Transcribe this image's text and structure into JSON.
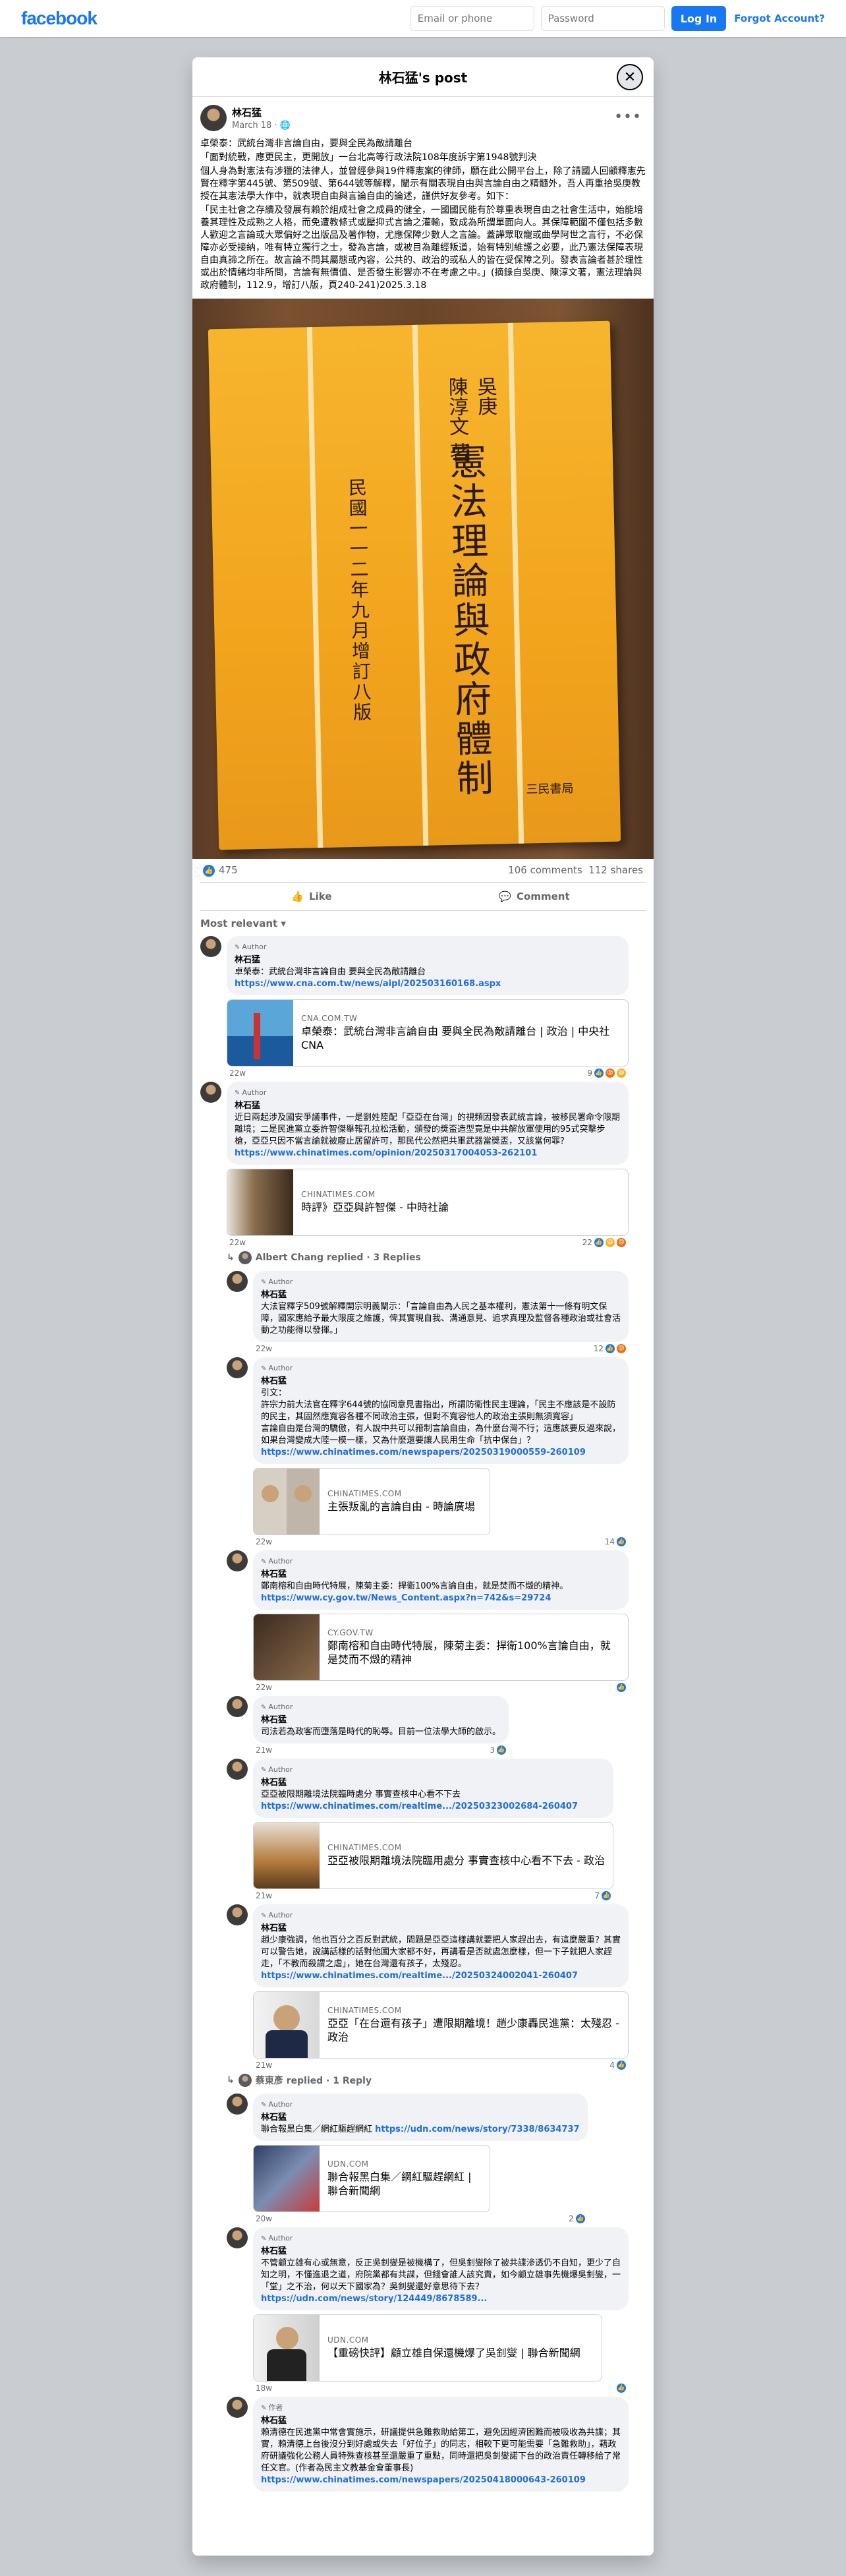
{
  "topbar": {
    "logo": "facebook",
    "email_placeholder": "Email or phone",
    "password_placeholder": "Password",
    "login": "Log In",
    "forgot": "Forgot Account?"
  },
  "modal": {
    "title": "林石猛's post"
  },
  "post": {
    "author": "林石猛",
    "date": "March 18",
    "privacy": "·",
    "text": [
      "卓榮泰：武統台灣非言論自由，要與全民為敵請離台",
      "「面對統戰，應更民主，更開放」一台北高等行政法院108年度訴字第1948號判決",
      "個人身為對憲法有涉獵的法律人，並曾經參與19件釋憲案的律師，願在此公開平台上，除了請國人回顧釋憲先賢在釋字第445號、第509號、第644號等解釋，闡示有關表現自由與言論自由之精髓外，吾人再重拾吳庚教授在其憲法學大作中，就表現自由與言論自由的論述，謹供好友參考。如下：",
      "「民主社會之存續及發展有賴於組成社會之成員的健全，一國國民能有於尊重表現自由之社會生活中，始能培養其理性及成熟之人格，而免遭教條式或壓抑式言論之灌輸，致成為所謂單面向人。其保障範圍不僅包括多數人歡迎之言論或大眾偏好之出版品及著作物，尤應保障少數人之言論。蓋譁眾取寵或曲學阿世之言行，不必保障亦必受接納，唯有特立獨行之士，發為言論，或被目為離經叛道，始有特別維護之必要，此乃憲法保障表現自由真諦之所在。故言論不問其屬態或內容，公共的、政治的或私人的皆在受保障之列。發表言論者甚於理性或出於情緒均非所問，言論有無價值、是否發生影響亦不在考慮之中。」(摘錄自吳庚、陳淳文著，憲法理論與政府體制，112.9，增訂八版，頁240-241)2025.3.18"
    ],
    "book": {
      "author": "吳庚\n陳淳文 著",
      "title": "憲法理論與政府體制",
      "edition": "民國一一二年九月增訂八版",
      "publisher": "三民書局"
    },
    "likes": "475",
    "comments": "106 comments",
    "shares": "112 shares",
    "like_label": "Like",
    "comment_label": "Comment",
    "sort": "Most relevant"
  },
  "comments": [
    {
      "author_tag": "Author",
      "name": "林石猛",
      "text": "卓榮泰：武統台灣非言論自由 要與全民為敵請離台",
      "link": "https://www.cna.com.tw/news/aipl/202503160168.aspx",
      "card": {
        "domain": "CNA.COM.TW",
        "title": "卓榮泰：武統台灣非言論自由 要與全民為敵請離台 | 政治 | 中央社 CNA"
      },
      "time": "22w",
      "count": "9"
    },
    {
      "author_tag": "Author",
      "name": "林石猛",
      "text": "近日兩起涉及國安爭議事件，一是劉姓陸配「亞亞在台灣」的視頻因發表武統言論，被移民署命令限期離境；二是民進黨立委許智傑舉報孔拉松活動，頒發的獎盃造型竟是中共解放軍使用的95式突擊步槍，亞亞只因不當言論就被廢止居留許可，那民代公然把共軍武器當獎盃，又該當何罪？",
      "link": "https://www.chinatimes.com/opinion/20250317004053-262101",
      "card": {
        "domain": "CHINATIMES.COM",
        "title": "時評》亞亞與許智傑 - 中時社論"
      },
      "time": "22w",
      "count": "22",
      "replies": "Albert Chang replied · 3 Replies"
    },
    {
      "author_tag": "Author",
      "name": "林石猛",
      "text": "大法官釋字509號解釋開宗明義闡示：「言論自由為人民之基本權利，憲法第十一條有明文保障，國家應給予最大限度之維護，俾其實現自我、溝通意見、追求真理及監督各種政治或社會活動之功能得以發揮。」",
      "time": "22w",
      "count": "12",
      "reply": true
    },
    {
      "author_tag": "Author",
      "name": "林石猛",
      "text": "引文：\n許宗力前大法官在釋字644號的協同意見書指出，所謂防衛性民主理論，「民主不應該是不設防的民主，其固然應寬容各種不同政治主張，但對不寬容他人的政治主張則無須寬容」\n言論自由是台灣的驕傲，有人說中共可以箝制言論自由，為什麼台灣不行；這應該要反過來說，如果台灣變成大陸一模一樣，又為什麼還要讓人民用生命「抗中保台」？",
      "link": "https://www.chinatimes.com/newspapers/20250319000559-260109",
      "card": {
        "domain": "CHINATIMES.COM",
        "title": "主張叛亂的言論自由 - 時論廣場"
      },
      "time": "22w",
      "count": "14",
      "reply": true
    },
    {
      "author_tag": "Author",
      "name": "林石猛",
      "text": "鄭南榕和自由時代特展，陳菊主委：捍衛100%言論自由，就是焚而不燬的精神。",
      "link": "https://www.cy.gov.tw/News_Content.aspx?n=742&s=29724",
      "card": {
        "domain": "CY.GOV.TW",
        "title": "鄭南榕和自由時代特展，陳菊主委：捍衛100%言論自由，就是焚而不燬的精神"
      },
      "time": "22w",
      "count": "",
      "reply": true
    },
    {
      "author_tag": "Author",
      "name": "林石猛",
      "text": "司法若為政客而墮落是時代的恥辱。目前一位法學大師的啟示。",
      "time": "21w",
      "count": "3",
      "reply": true
    },
    {
      "author_tag": "Author",
      "name": "林石猛",
      "text": "亞亞被限期離境法院臨時處分 事實查核中心看不下去",
      "link": "https://www.chinatimes.com/realtime.../20250323002684-260407",
      "card": {
        "domain": "CHINATIMES.COM",
        "title": "亞亞被限期離境法院臨用處分 事實查核中心看不下去 - 政治"
      },
      "time": "21w",
      "count": "7",
      "reply": true
    },
    {
      "author_tag": "Author",
      "name": "林石猛",
      "text": "趙少康強調，他也百分之百反對武統，問題是亞亞這樣講就要把人家趕出去，有這麼嚴重？其實可以警告她，說講話樣的話對他國大家都不好，再講看是否就處怎麼樣，但一下子就把人家趕走，「不教而殺謂之虐」，她在台灣還有孩子，太殘忍。",
      "link": "https://www.chinatimes.com/realtime.../20250324002041-260407",
      "card": {
        "domain": "CHINATIMES.COM",
        "title": "亞亞「在台還有孩子」遭限期離境！趙少康轟民進黨：太殘忍 - 政治"
      },
      "time": "21w",
      "count": "4",
      "reply": true,
      "replies": "蔡東彥 replied · 1 Reply"
    },
    {
      "author_tag": "Author",
      "name": "林石猛",
      "text": "聯合報黑白集／網紅驅趕網紅",
      "link": "https://udn.com/news/story/7338/8634737",
      "inline_link": true,
      "card": {
        "domain": "UDN.COM",
        "title": "聯合報黑白集／網紅驅趕網紅 | 聯合新聞網"
      },
      "time": "20w",
      "count": "2",
      "reply": true
    },
    {
      "author_tag": "Author",
      "name": "林石猛",
      "text": "不管顧立雄有心或無意，反正吳釗燮是被機構了，但吳釗燮除了被共諜滲透仍不自知，更少了自知之明，不懂進退之道，府院黨都有共諜，但錢會誰人該究責，如今顧立雄事先機爆吳釗燮，一「堂」之不治，何以天下國家為？吳釗燮還好意思待下去？",
      "link": "https://udn.com/news/story/124449/8678589...",
      "card": {
        "domain": "UDN.COM",
        "title": "【重磅快評】顧立雄自保還機爆了吳釗燮 | 聯合新聞網"
      },
      "time": "18w",
      "count": "",
      "reply": true
    },
    {
      "author_tag": "作者",
      "name": "林石猛",
      "text": "賴清德在民進黨中常會實施示，研議提供急難救助給第工，避免因經濟困難而被吸收為共諜；其實，賴清德上台後沒分到好處或失去「好位子」的同志，相較下更可能需要「急難救助」，藉政府研議強化公務人員特殊查核甚至還嚴重了重點，同時還把吳釗燮諾下台的政治責任轉移給了常任文官。(作者為民主文教基金會董事長)",
      "link": "https://www.chinatimes.com/newspapers/20250418000643-260109",
      "reply": true
    }
  ]
}
